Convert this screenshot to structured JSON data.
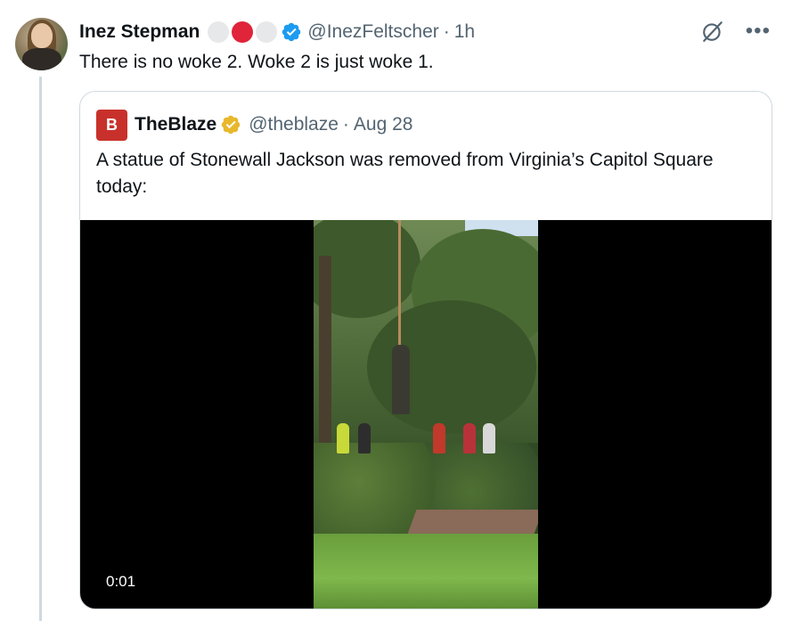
{
  "post": {
    "author_name": "Inez Stepman",
    "handle": "@InezFeltscher",
    "separator": "·",
    "time": "1h",
    "text": "There is no woke 2. Woke 2 is just woke 1.",
    "badge_colors": [
      "#e6e8ea",
      "#e0243a",
      "#e6e8ea"
    ],
    "verified_color": "#1d9bf0",
    "icons": [
      "grok-icon",
      "more-icon"
    ]
  },
  "quote": {
    "logo_text": "B",
    "author_name": "TheBlaze",
    "handle": "@theblaze",
    "separator": "·",
    "time": "Aug 28",
    "text": "A statue of Stonewall Jackson was removed from Virginia’s Capitol Square today:",
    "verified_color": "#e8b82c",
    "brand_color": "#c8312b"
  },
  "video": {
    "timestamp": "0:01"
  }
}
